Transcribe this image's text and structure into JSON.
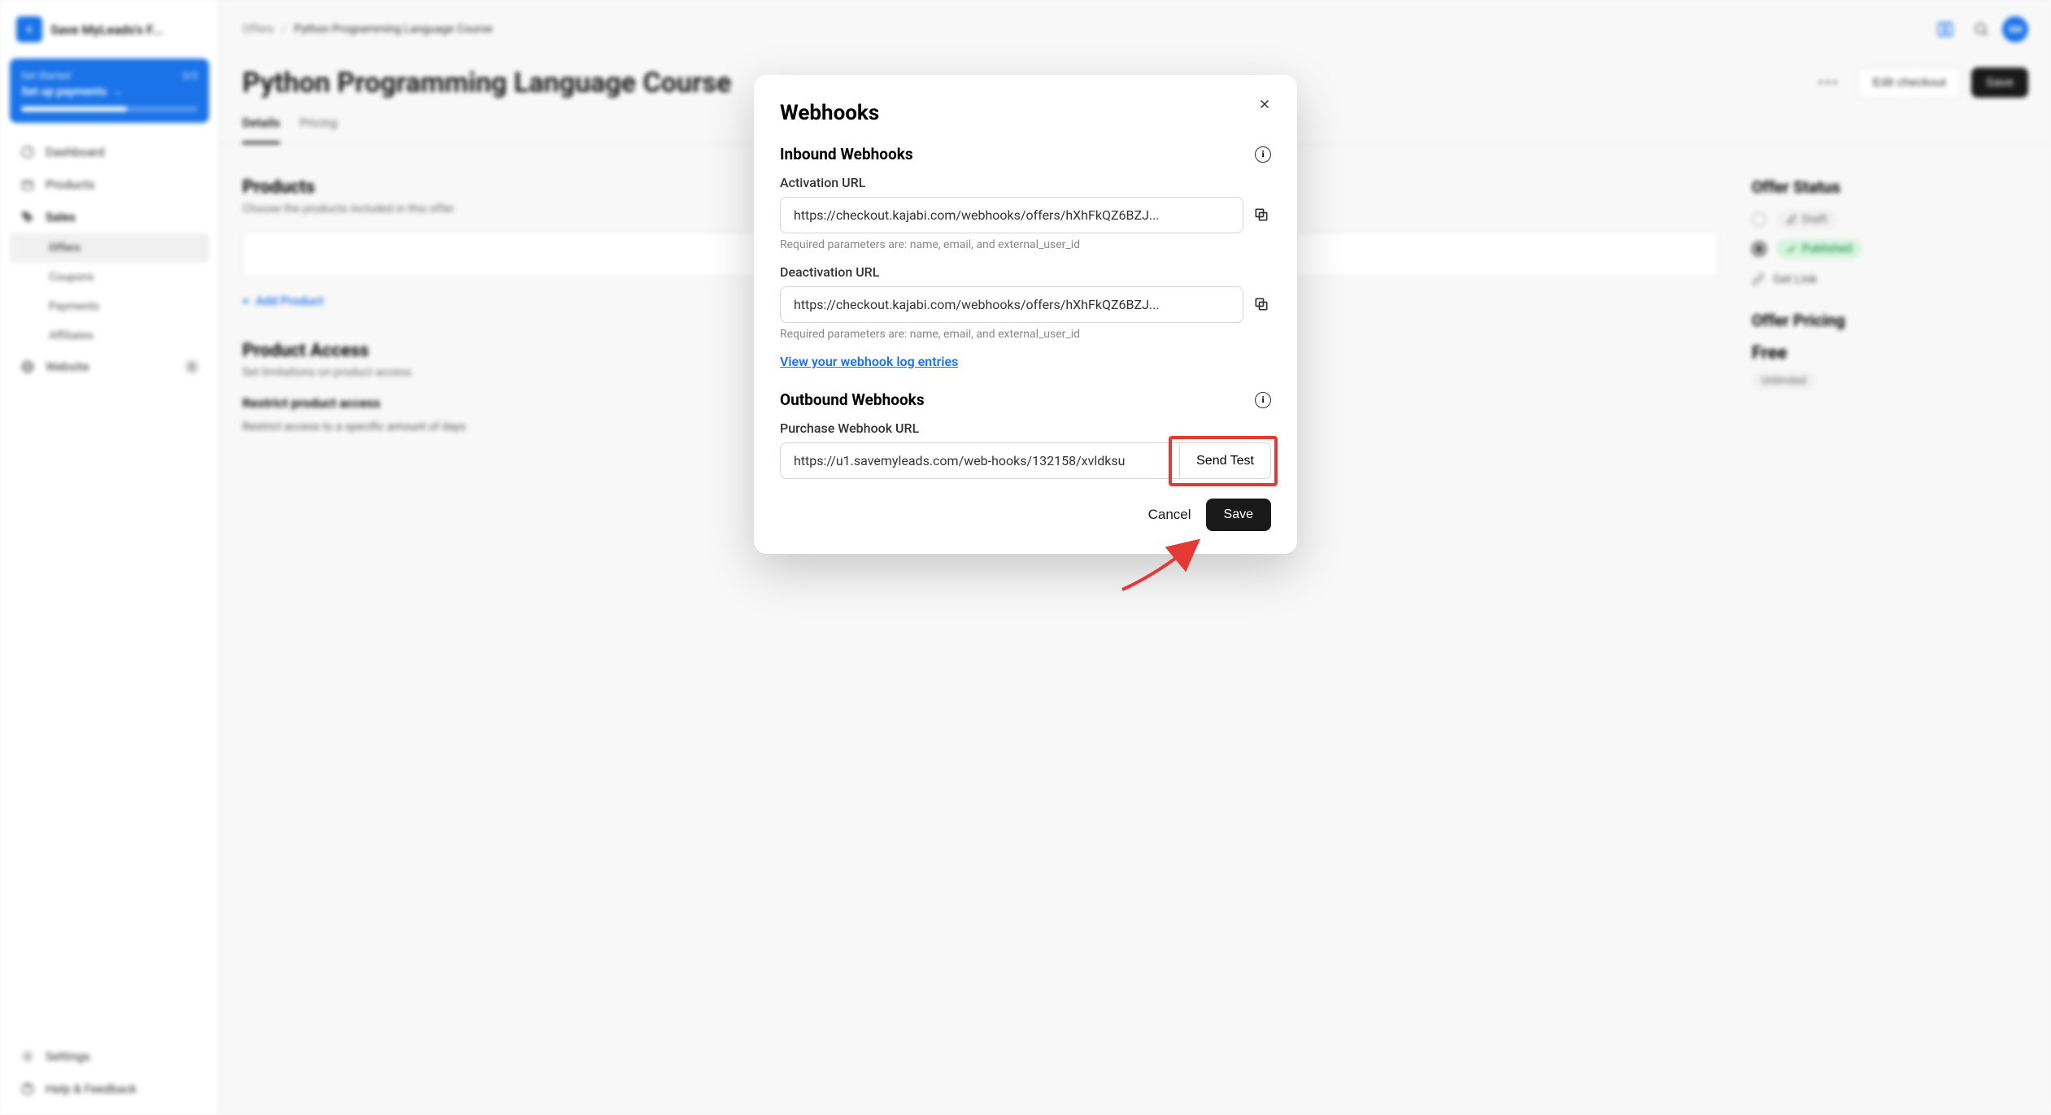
{
  "sidebar": {
    "site_title": "Save MyLeads's F...",
    "get_started": {
      "label": "Get Started",
      "count": "3/5",
      "task": "Set up payments"
    },
    "items": [
      {
        "label": "Dashboard"
      },
      {
        "label": "Products"
      },
      {
        "label": "Sales"
      },
      {
        "label": "Offers"
      },
      {
        "label": "Coupons"
      },
      {
        "label": "Payments"
      },
      {
        "label": "Affiliates"
      },
      {
        "label": "Website"
      },
      {
        "label": "Settings"
      },
      {
        "label": "Help & Feedback"
      }
    ],
    "website_badge": "0"
  },
  "breadcrumb": {
    "root": "Offers",
    "current": "Python Programming Language Course"
  },
  "page": {
    "title": "Python Programming Language Course",
    "edit_checkout": "Edit checkout",
    "save": "Save"
  },
  "tabs": {
    "details": "Details",
    "pricing": "Pricing"
  },
  "content": {
    "products_title": "Products",
    "products_desc": "Choose the products included in this offer.",
    "add_product": "Add Product",
    "product_access_title": "Product Access",
    "product_access_desc": "Set limitations on product access.",
    "restrict_label": "Restrict product access",
    "restrict_desc": "Restrict access to a specific amount of days"
  },
  "side": {
    "status_title": "Offer Status",
    "draft": "Draft",
    "published": "Published",
    "get_link": "Get Link",
    "pricing_title": "Offer Pricing",
    "free": "Free",
    "unlimited": "Unlimited"
  },
  "avatar_initials": "SM",
  "modal": {
    "title": "Webhooks",
    "inbound_title": "Inbound Webhooks",
    "activation_label": "Activation URL",
    "activation_url": "https://checkout.kajabi.com/webhooks/offers/hXhFkQZ6BZJ...",
    "deactivation_label": "Deactivation URL",
    "deactivation_url": "https://checkout.kajabi.com/webhooks/offers/hXhFkQZ6BZJ...",
    "params_hint": "Required parameters are: name, email, and external_user_id",
    "log_link": "View your webhook log entries",
    "outbound_title": "Outbound Webhooks",
    "purchase_label": "Purchase Webhook URL",
    "purchase_url": "https://u1.savemyleads.com/web-hooks/132158/xvldksu",
    "send_test": "Send Test",
    "cancel": "Cancel",
    "save": "Save"
  }
}
